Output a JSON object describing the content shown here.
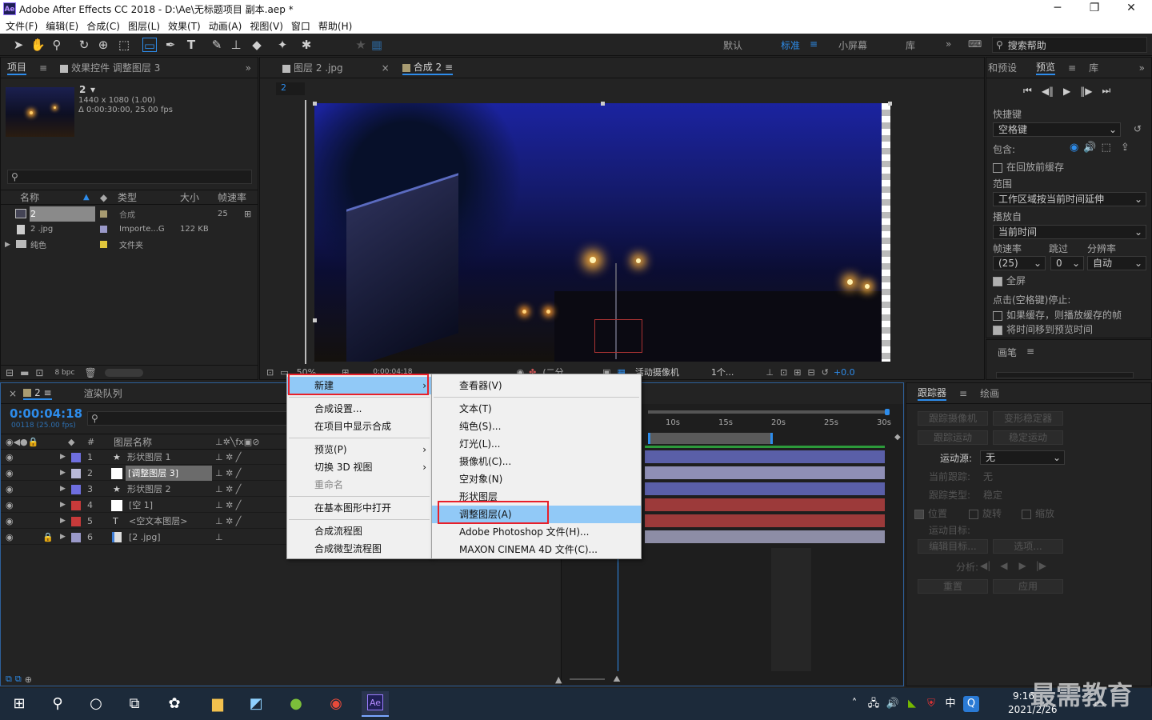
{
  "window": {
    "title": "Adobe After Effects CC 2018 - D:\\Ae\\无标题项目 副本.aep *",
    "app_logo": "Ae",
    "controls": [
      "─",
      "❐",
      "✕"
    ]
  },
  "menubar": [
    "文件(F)",
    "编辑(E)",
    "合成(C)",
    "图层(L)",
    "效果(T)",
    "动画(A)",
    "视图(V)",
    "窗口",
    "帮助(H)"
  ],
  "workspaces": {
    "items": [
      "默认",
      "标准",
      "小屏幕",
      "库"
    ],
    "active": "标准",
    "search_placeholder": "搜索帮助"
  },
  "project_panel": {
    "tabs": [
      "项目",
      "效果控件 调整图层 3"
    ],
    "comp_name": "2",
    "comp_info1": "1440 x 1080 (1.00)",
    "comp_info2": "Δ 0:00:30:00, 25.00 fps",
    "columns": [
      "名称",
      "类型",
      "大小",
      "帧速率"
    ],
    "rows": [
      {
        "name": "2",
        "type": "合成",
        "size": "",
        "fps": "25",
        "color": "#a89b71"
      },
      {
        "name": "2 .jpg",
        "type": "Importe...G",
        "size": "122 KB",
        "fps": "",
        "color": "#9a99c9"
      },
      {
        "name": "纯色",
        "type": "文件夹",
        "size": "",
        "fps": "",
        "color": "#e0c63c"
      }
    ],
    "bpc": "8 bpc"
  },
  "comp_panel": {
    "tabs": [
      "图层 2 .jpg",
      "合成 2"
    ],
    "breadcrumb": "2",
    "zoom": "50%",
    "timecode": "0:00:04:18",
    "quality": "(二分...",
    "camera": "活动摄像机",
    "views": "1个...",
    "exposure": "+0.0"
  },
  "timeline": {
    "tab_comp": "2",
    "tab_render": "渲染队列",
    "timecode": "0:00:04:18",
    "fps_info": "00118 (25.00 fps)",
    "col_layer": "图层名称",
    "layers": [
      {
        "num": "1",
        "name": "形状图层 1",
        "color": "#6f6fe0",
        "icon": "★"
      },
      {
        "num": "2",
        "name": "[调整图层 3]",
        "color": "#b9b9d8",
        "icon": ""
      },
      {
        "num": "3",
        "name": "形状图层 2",
        "color": "#6f6fe0",
        "icon": "★"
      },
      {
        "num": "4",
        "name": "[空 1]",
        "color": "#c83a3a",
        "icon": ""
      },
      {
        "num": "5",
        "name": "<空文本图层>",
        "color": "#c83a3a",
        "icon": "T"
      },
      {
        "num": "6",
        "name": "[2 .jpg]",
        "color": "#9a99c9",
        "icon": ""
      }
    ],
    "ruler": [
      "10s",
      "15s",
      "20s",
      "25s",
      "30s"
    ],
    "bar_colors": [
      "#5a5fa8",
      "#8f8fb6",
      "#5a5fa8",
      "#9c3a3a",
      "#9c3a3a",
      "#8d8da6"
    ]
  },
  "context_menu": {
    "items": [
      {
        "label": "新建",
        "highlight": true,
        "sub": true
      },
      {
        "sep": true
      },
      {
        "label": "合成设置..."
      },
      {
        "label": "在项目中显示合成"
      },
      {
        "sep": true
      },
      {
        "label": "预览(P)",
        "sub": true
      },
      {
        "label": "切换 3D 视图",
        "sub": true
      },
      {
        "label": "重命名",
        "disabled": true
      },
      {
        "sep": true
      },
      {
        "label": "在基本图形中打开"
      },
      {
        "sep": true
      },
      {
        "label": "合成流程图"
      },
      {
        "label": "合成微型流程图"
      }
    ],
    "submenu": [
      {
        "label": "查看器(V)"
      },
      {
        "sep": true
      },
      {
        "label": "文本(T)"
      },
      {
        "label": "纯色(S)..."
      },
      {
        "label": "灯光(L)..."
      },
      {
        "label": "摄像机(C)..."
      },
      {
        "label": "空对象(N)"
      },
      {
        "label": "形状图层"
      },
      {
        "label": "调整图层(A)",
        "highlight": true
      },
      {
        "label": "Adobe Photoshop 文件(H)..."
      },
      {
        "label": "MAXON CINEMA 4D 文件(C)..."
      }
    ]
  },
  "preview_panel": {
    "tabs": [
      "和预设",
      "预览",
      "库"
    ],
    "shortcut_label": "快捷键",
    "shortcut_value": "空格键",
    "include_label": "包含:",
    "cache_label": "在回放前缓存",
    "range_label": "范围",
    "range_value": "工作区域按当前时间延伸",
    "play_from_label": "播放自",
    "play_from_value": "当前时间",
    "fps_label": "帧速率",
    "skip_label": "跳过",
    "res_label": "分辨率",
    "fps_value": "(25)",
    "skip_value": "0",
    "res_value": "自动",
    "fullscreen_label": "全屏",
    "stop_label": "点击(空格键)停止:",
    "opt1": "如果缓存，则播放缓存的帧",
    "opt2": "将时间移到预览时间",
    "brush_tab": "画笔"
  },
  "tracker_panel": {
    "tabs": [
      "跟踪器",
      "绘画"
    ],
    "btn_track_camera": "跟踪摄像机",
    "btn_warp": "变形稳定器",
    "btn_track_motion": "跟踪运动",
    "btn_stabilize": "稳定运动",
    "motion_source_label": "运动源:",
    "motion_source_value": "无",
    "current_track_label": "当前跟踪:",
    "current_track_value": "无",
    "track_type_label": "跟踪类型:",
    "track_type_value": "稳定",
    "pos": "位置",
    "rot": "旋转",
    "scale": "缩放",
    "target_label": "运动目标:",
    "edit_target": "编辑目标...",
    "options": "选项...",
    "analyze_label": "分析:",
    "reset": "重置",
    "apply": "应用"
  },
  "taskbar": {
    "time": "9:16",
    "date": "2021/2/26",
    "ime": "中",
    "watermark": "最需教育"
  }
}
